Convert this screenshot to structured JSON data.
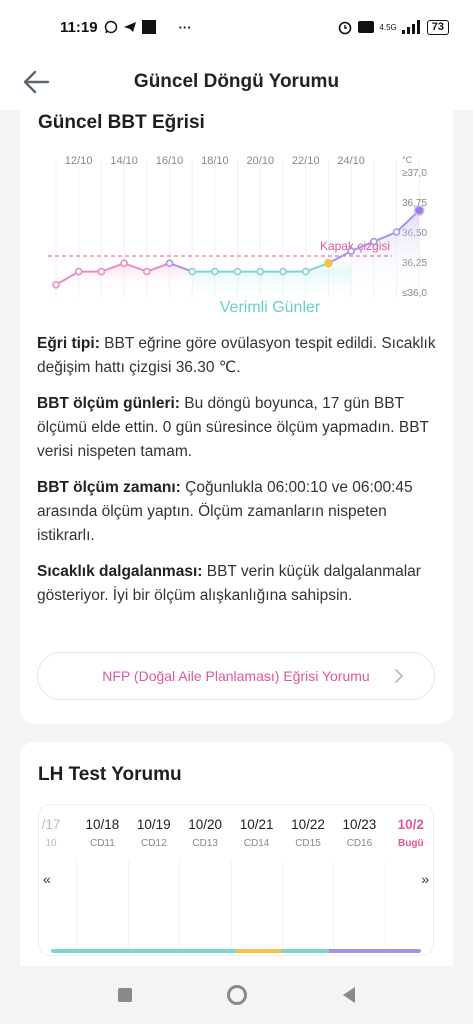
{
  "status": {
    "time": "11:19",
    "more": "···",
    "network": "4.5G",
    "battery": "73"
  },
  "header": {
    "title": "Güncel Döngü Yorumu"
  },
  "bbt": {
    "title": "Güncel BBT Eğrisi",
    "cover_line_label": "Kapak çizgisi",
    "fertile_label": "Verimli Günler",
    "unit": "°C",
    "colors": {
      "pink": "#e58fc4",
      "purple": "#a993e6",
      "teal": "#7fd6d0",
      "orange": "#f3c24a",
      "coverline": "#e0589a"
    }
  },
  "chart_data": {
    "type": "line",
    "x_ticks": [
      "12/10",
      "14/10",
      "16/10",
      "18/10",
      "20/10",
      "22/10",
      "24/10"
    ],
    "y_ticks": [
      "≥37,0",
      "36,75",
      "36,50",
      "36,25",
      "≤36,0"
    ],
    "ylim": [
      36.0,
      37.0
    ],
    "cover_line": 36.3,
    "values": [
      36.06,
      36.17,
      36.17,
      36.24,
      36.17,
      36.24,
      36.17,
      36.17,
      36.17,
      36.17,
      36.17,
      36.17,
      36.24,
      36.34,
      36.42,
      36.5,
      36.68
    ]
  },
  "summary": [
    {
      "label": "Eğri tipi:",
      "text": " BBT eğrine göre ovülasyon tespit edildi. Sıcaklık değişim hattı çizgisi 36.30 ℃."
    },
    {
      "label": "BBT ölçüm günleri:",
      "text": " Bu döngü boyunca, 17 gün BBT ölçümü elde ettin. 0 gün süresince ölçüm yapmadın. BBT verisi nispeten tamam."
    },
    {
      "label": "BBT ölçüm zamanı:",
      "text": " Çoğunlukla 06:00:10 ve 06:00:45 arasında ölçüm yaptın. Ölçüm zamanların nispeten istikrarlı."
    },
    {
      "label": "Sıcaklık dalgalanması:",
      "text": " BBT verin küçük dalgalanmalar gösteriyor. İyi bir ölçüm alışkanlığına sahipsin."
    }
  ],
  "nfp_button": {
    "label": "NFP (Doğal Aile Planlaması) Eğrisi Yorumu"
  },
  "lh": {
    "title": "LH Test Yorumu",
    "prev": "«",
    "next": "»",
    "days": [
      {
        "date": "/17",
        "cd": "10",
        "state": "faded"
      },
      {
        "date": "10/18",
        "cd": "CD11",
        "state": "normal"
      },
      {
        "date": "10/19",
        "cd": "CD12",
        "state": "normal"
      },
      {
        "date": "10/20",
        "cd": "CD13",
        "state": "normal"
      },
      {
        "date": "10/21",
        "cd": "CD14",
        "state": "normal"
      },
      {
        "date": "10/22",
        "cd": "CD15",
        "state": "normal"
      },
      {
        "date": "10/23",
        "cd": "CD16",
        "state": "normal"
      },
      {
        "date": "10/2",
        "cd": "Bugü",
        "state": "today"
      }
    ]
  }
}
